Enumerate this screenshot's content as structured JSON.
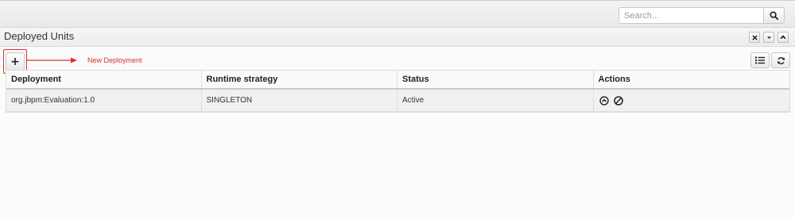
{
  "search": {
    "placeholder": "Search..."
  },
  "panel": {
    "title": "Deployed Units"
  },
  "toolbar": {
    "add_label": "+"
  },
  "callout": {
    "label": "New Deployment",
    "color": "#e0312d"
  },
  "table": {
    "columns": [
      "Deployment",
      "Runtime strategy",
      "Status",
      "Actions"
    ],
    "rows": [
      {
        "deployment": "org.jbpm:Evaluation:1.0",
        "runtime_strategy": "SINGLETON",
        "status": "Active",
        "actions": [
          "undeploy-icon",
          "deactivate-icon"
        ]
      }
    ]
  },
  "icons": {
    "search": "search-icon",
    "header": [
      "close-icon",
      "collapse-icon",
      "maximize-icon"
    ],
    "toolbar": [
      "list-icon",
      "refresh-icon"
    ]
  }
}
